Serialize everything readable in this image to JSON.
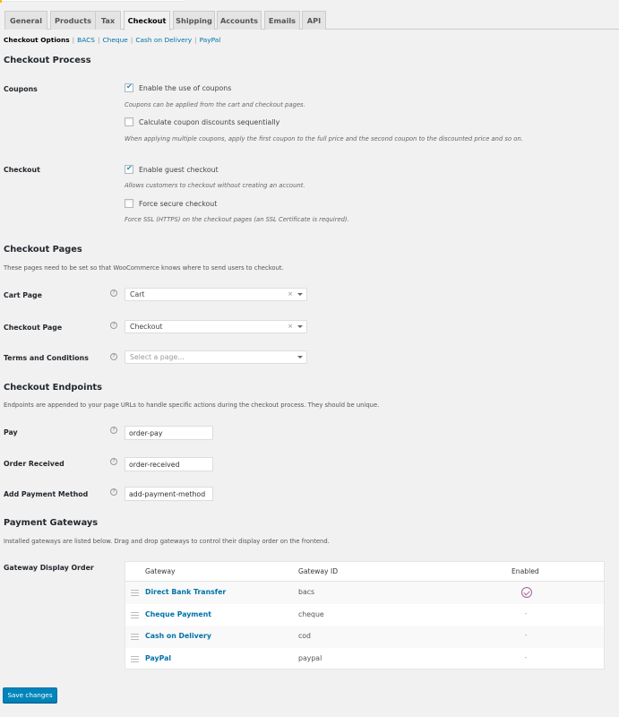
{
  "tabs": [
    {
      "label": "General",
      "active": false
    },
    {
      "label": "Products",
      "active": false
    },
    {
      "label": "Tax",
      "active": false
    },
    {
      "label": "Checkout",
      "active": true
    },
    {
      "label": "Shipping",
      "active": false
    },
    {
      "label": "Accounts",
      "active": false
    },
    {
      "label": "Emails",
      "active": false
    },
    {
      "label": "API",
      "active": false
    }
  ],
  "subnav": {
    "current": "Checkout Options",
    "links": [
      "BACS",
      "Cheque",
      "Cash on Delivery",
      "PayPal"
    ],
    "separator": "|"
  },
  "checkout_process": {
    "title": "Checkout Process",
    "coupons": {
      "label": "Coupons",
      "enable": {
        "label": "Enable the use of coupons",
        "checked": true
      },
      "enable_hint": "Coupons can be applied from the cart and checkout pages.",
      "sequential": {
        "label": "Calculate coupon discounts sequentially",
        "checked": false
      },
      "sequential_hint": "When applying multiple coupons, apply the first coupon to the full price and the second coupon to the discounted price and so on."
    },
    "checkout": {
      "label": "Checkout",
      "guest": {
        "label": "Enable guest checkout",
        "checked": true
      },
      "guest_hint": "Allows customers to checkout without creating an account.",
      "secure": {
        "label": "Force secure checkout",
        "checked": false
      },
      "secure_hint": "Force SSL (HTTPS) on the checkout pages (an SSL Certificate is required)."
    }
  },
  "checkout_pages": {
    "title": "Checkout Pages",
    "description": "These pages need to be set so that WooCommerce knows where to send users to checkout.",
    "cart": {
      "label": "Cart Page",
      "value": "Cart",
      "clear": "×"
    },
    "checkout": {
      "label": "Checkout Page",
      "value": "Checkout",
      "clear": "×"
    },
    "terms": {
      "label": "Terms and Conditions",
      "placeholder": "Select a page..."
    }
  },
  "endpoints": {
    "title": "Checkout Endpoints",
    "description": "Endpoints are appended to your page URLs to handle specific actions during the checkout process. They should be unique.",
    "pay": {
      "label": "Pay",
      "value": "order-pay"
    },
    "order_received": {
      "label": "Order Received",
      "value": "order-received"
    },
    "add_payment_method": {
      "label": "Add Payment Method",
      "value": "add-payment-method"
    }
  },
  "gateways": {
    "title": "Payment Gateways",
    "description": "Installed gateways are listed below. Drag and drop gateways to control their display order on the frontend.",
    "label": "Gateway Display Order",
    "columns": {
      "gateway": "Gateway",
      "id": "Gateway ID",
      "enabled": "Enabled"
    },
    "rows": [
      {
        "name": "Direct Bank Transfer",
        "id": "bacs",
        "enabled": true,
        "enabled_text": ""
      },
      {
        "name": "Cheque Payment",
        "id": "cheque",
        "enabled": false,
        "enabled_text": "-"
      },
      {
        "name": "Cash on Delivery",
        "id": "cod",
        "enabled": false,
        "enabled_text": "-"
      },
      {
        "name": "PayPal",
        "id": "paypal",
        "enabled": false,
        "enabled_text": "-"
      }
    ]
  },
  "help_glyph": "?",
  "save_label": "Save changes",
  "colors": {
    "accent": "#0073aa",
    "button": "#0085ba",
    "enabled_icon": "#a46497"
  }
}
